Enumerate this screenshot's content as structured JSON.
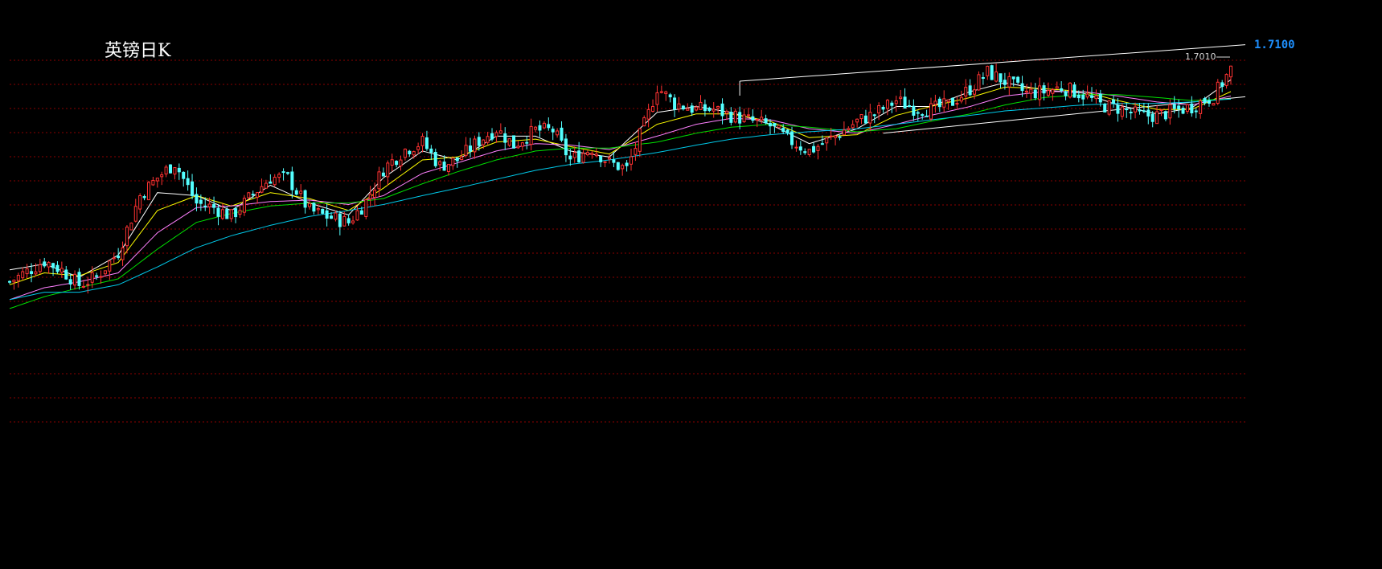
{
  "chart_data": {
    "type": "candlestick",
    "title": "英镑日K",
    "right_price_label": "1.7100",
    "annotation_high": "1.7010",
    "grid": "dotted-red-horizontal",
    "colors": {
      "background": "#000000",
      "grid": "#8b0000",
      "up": "#ff3232",
      "down": "#54ffff",
      "ma5": "#ffffff",
      "ma10": "#ffff00",
      "ma20": "#ff80ff",
      "ma30": "#00e000",
      "ma60": "#00c8e8",
      "channel": "#ffffff",
      "price_label": "#1e90ff"
    },
    "close_path": [
      [
        0,
        1.552
      ],
      [
        8,
        1.566
      ],
      [
        12,
        1.56
      ],
      [
        16,
        1.55
      ],
      [
        20,
        1.555
      ],
      [
        25,
        1.572
      ],
      [
        30,
        1.61
      ],
      [
        34,
        1.622
      ],
      [
        38,
        1.632
      ],
      [
        43,
        1.605
      ],
      [
        47,
        1.602
      ],
      [
        51,
        1.596
      ],
      [
        56,
        1.611
      ],
      [
        60,
        1.622
      ],
      [
        64,
        1.622
      ],
      [
        69,
        1.6
      ],
      [
        73,
        1.596
      ],
      [
        78,
        1.592
      ],
      [
        82,
        1.606
      ],
      [
        86,
        1.628
      ],
      [
        91,
        1.641
      ],
      [
        95,
        1.646
      ],
      [
        99,
        1.63
      ],
      [
        103,
        1.634
      ],
      [
        108,
        1.647
      ],
      [
        112,
        1.655
      ],
      [
        116,
        1.644
      ],
      [
        121,
        1.654
      ],
      [
        125,
        1.654
      ],
      [
        129,
        1.634
      ],
      [
        134,
        1.642
      ],
      [
        138,
        1.632
      ],
      [
        142,
        1.628
      ],
      [
        147,
        1.665
      ],
      [
        149,
        1.683
      ],
      [
        153,
        1.672
      ],
      [
        158,
        1.668
      ],
      [
        162,
        1.668
      ],
      [
        166,
        1.664
      ],
      [
        171,
        1.66
      ],
      [
        175,
        1.657
      ],
      [
        179,
        1.648
      ],
      [
        184,
        1.64
      ],
      [
        190,
        1.65
      ],
      [
        195,
        1.66
      ],
      [
        199,
        1.665
      ],
      [
        204,
        1.674
      ],
      [
        208,
        1.669
      ],
      [
        212,
        1.668
      ],
      [
        216,
        1.671
      ],
      [
        221,
        1.682
      ],
      [
        225,
        1.693
      ],
      [
        229,
        1.687
      ],
      [
        234,
        1.679
      ],
      [
        238,
        1.68
      ],
      [
        242,
        1.683
      ],
      [
        247,
        1.678
      ],
      [
        251,
        1.671
      ],
      [
        255,
        1.669
      ],
      [
        260,
        1.664
      ],
      [
        264,
        1.664
      ],
      [
        268,
        1.667
      ],
      [
        272,
        1.67
      ],
      [
        277,
        1.677
      ],
      [
        281,
        1.695
      ]
    ],
    "ma_series": [
      {
        "key": "ma5",
        "values": [
          [
            0,
            1.56
          ],
          [
            8,
            1.564
          ],
          [
            16,
            1.555
          ],
          [
            25,
            1.57
          ],
          [
            34,
            1.612
          ],
          [
            43,
            1.61
          ],
          [
            51,
            1.6
          ],
          [
            60,
            1.617
          ],
          [
            69,
            1.605
          ],
          [
            78,
            1.597
          ],
          [
            86,
            1.622
          ],
          [
            95,
            1.64
          ],
          [
            103,
            1.634
          ],
          [
            112,
            1.65
          ],
          [
            121,
            1.65
          ],
          [
            129,
            1.64
          ],
          [
            138,
            1.636
          ],
          [
            149,
            1.666
          ],
          [
            158,
            1.67
          ],
          [
            166,
            1.666
          ],
          [
            175,
            1.658
          ],
          [
            184,
            1.645
          ],
          [
            195,
            1.655
          ],
          [
            204,
            1.67
          ],
          [
            212,
            1.67
          ],
          [
            221,
            1.68
          ],
          [
            229,
            1.686
          ],
          [
            238,
            1.681
          ],
          [
            247,
            1.679
          ],
          [
            255,
            1.671
          ],
          [
            264,
            1.665
          ],
          [
            272,
            1.669
          ],
          [
            281,
            1.688
          ]
        ]
      },
      {
        "key": "ma10",
        "values": [
          [
            0,
            1.55
          ],
          [
            8,
            1.558
          ],
          [
            16,
            1.556
          ],
          [
            25,
            1.565
          ],
          [
            34,
            1.6
          ],
          [
            43,
            1.61
          ],
          [
            51,
            1.603
          ],
          [
            60,
            1.612
          ],
          [
            69,
            1.608
          ],
          [
            78,
            1.6
          ],
          [
            86,
            1.615
          ],
          [
            95,
            1.634
          ],
          [
            103,
            1.636
          ],
          [
            112,
            1.646
          ],
          [
            121,
            1.648
          ],
          [
            129,
            1.643
          ],
          [
            138,
            1.638
          ],
          [
            149,
            1.658
          ],
          [
            158,
            1.665
          ],
          [
            166,
            1.665
          ],
          [
            175,
            1.66
          ],
          [
            184,
            1.649
          ],
          [
            195,
            1.651
          ],
          [
            204,
            1.664
          ],
          [
            212,
            1.67
          ],
          [
            221,
            1.676
          ],
          [
            229,
            1.683
          ],
          [
            238,
            1.682
          ],
          [
            247,
            1.68
          ],
          [
            255,
            1.674
          ],
          [
            264,
            1.668
          ],
          [
            272,
            1.668
          ],
          [
            281,
            1.68
          ]
        ]
      },
      {
        "key": "ma20",
        "values": [
          [
            0,
            1.54
          ],
          [
            8,
            1.548
          ],
          [
            16,
            1.552
          ],
          [
            25,
            1.558
          ],
          [
            34,
            1.585
          ],
          [
            43,
            1.602
          ],
          [
            51,
            1.603
          ],
          [
            60,
            1.606
          ],
          [
            69,
            1.607
          ],
          [
            78,
            1.604
          ],
          [
            86,
            1.61
          ],
          [
            95,
            1.625
          ],
          [
            103,
            1.632
          ],
          [
            112,
            1.64
          ],
          [
            121,
            1.645
          ],
          [
            129,
            1.644
          ],
          [
            138,
            1.641
          ],
          [
            149,
            1.65
          ],
          [
            158,
            1.658
          ],
          [
            166,
            1.662
          ],
          [
            175,
            1.661
          ],
          [
            184,
            1.655
          ],
          [
            195,
            1.652
          ],
          [
            204,
            1.658
          ],
          [
            212,
            1.664
          ],
          [
            221,
            1.67
          ],
          [
            229,
            1.677
          ],
          [
            238,
            1.68
          ],
          [
            247,
            1.68
          ],
          [
            255,
            1.677
          ],
          [
            264,
            1.673
          ],
          [
            272,
            1.671
          ],
          [
            281,
            1.677
          ]
        ]
      },
      {
        "key": "ma30",
        "values": [
          [
            0,
            1.534
          ],
          [
            8,
            1.542
          ],
          [
            16,
            1.548
          ],
          [
            25,
            1.554
          ],
          [
            34,
            1.574
          ],
          [
            43,
            1.592
          ],
          [
            51,
            1.598
          ],
          [
            60,
            1.603
          ],
          [
            69,
            1.605
          ],
          [
            78,
            1.605
          ],
          [
            86,
            1.608
          ],
          [
            95,
            1.618
          ],
          [
            103,
            1.626
          ],
          [
            112,
            1.634
          ],
          [
            121,
            1.64
          ],
          [
            129,
            1.642
          ],
          [
            138,
            1.642
          ],
          [
            149,
            1.646
          ],
          [
            158,
            1.652
          ],
          [
            166,
            1.656
          ],
          [
            175,
            1.658
          ],
          [
            184,
            1.656
          ],
          [
            195,
            1.653
          ],
          [
            204,
            1.655
          ],
          [
            212,
            1.66
          ],
          [
            221,
            1.665
          ],
          [
            229,
            1.671
          ],
          [
            238,
            1.676
          ],
          [
            247,
            1.678
          ],
          [
            255,
            1.678
          ],
          [
            264,
            1.676
          ],
          [
            272,
            1.674
          ],
          [
            281,
            1.675
          ]
        ]
      },
      {
        "key": "ma60",
        "values": [
          [
            0,
            1.54
          ],
          [
            8,
            1.545
          ],
          [
            16,
            1.545
          ],
          [
            25,
            1.55
          ],
          [
            34,
            1.562
          ],
          [
            43,
            1.575
          ],
          [
            51,
            1.583
          ],
          [
            60,
            1.59
          ],
          [
            69,
            1.596
          ],
          [
            78,
            1.6
          ],
          [
            86,
            1.604
          ],
          [
            95,
            1.61
          ],
          [
            103,
            1.615
          ],
          [
            112,
            1.621
          ],
          [
            121,
            1.627
          ],
          [
            129,
            1.631
          ],
          [
            138,
            1.634
          ],
          [
            149,
            1.639
          ],
          [
            158,
            1.644
          ],
          [
            166,
            1.648
          ],
          [
            175,
            1.651
          ],
          [
            184,
            1.653
          ],
          [
            195,
            1.655
          ],
          [
            204,
            1.658
          ],
          [
            212,
            1.661
          ],
          [
            221,
            1.664
          ],
          [
            229,
            1.667
          ],
          [
            238,
            1.669
          ],
          [
            247,
            1.671
          ],
          [
            255,
            1.672
          ],
          [
            264,
            1.672
          ],
          [
            272,
            1.673
          ],
          [
            281,
            1.675
          ]
        ]
      }
    ],
    "channel_lines": [
      {
        "from": [
          168,
          1.687
        ],
        "to": [
          281,
          1.711
        ]
      },
      {
        "from": [
          201,
          1.652
        ],
        "to": [
          281,
          1.676
        ]
      }
    ],
    "y_range": [
      1.455,
      1.72
    ]
  }
}
